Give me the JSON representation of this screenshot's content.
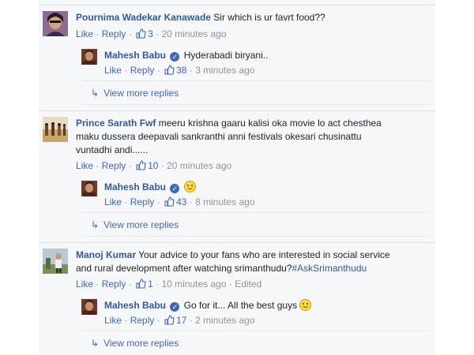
{
  "actions": {
    "like": "Like",
    "reply": "Reply",
    "sep": "·"
  },
  "comments": [
    {
      "author": "Pournima Wadekar Kanawade",
      "text": "Sir which is ur favrt food??",
      "likes": "3",
      "time": "20 minutes ago",
      "reply": {
        "author": "Mahesh Babu",
        "text": "Hyderabadi biryani..",
        "likes": "38",
        "time": "3 minutes ago"
      },
      "more": "View more replies"
    },
    {
      "author": "Prince Sarath Fwf",
      "text_lines": [
        "meeru krishna gaaru kalisi oka movie lo act chesthea",
        "maku dussera deepavali sankranthi anni festivals okesari chusinattu",
        "vuntadhi andi......"
      ],
      "likes": "10",
      "time": "20 minutes ago",
      "reply": {
        "author": "Mahesh Babu",
        "text": "",
        "likes": "43",
        "time": "8 minutes ago"
      },
      "more": "View more replies"
    },
    {
      "author": "Manoj Kumar",
      "text_line1": "Your advice to your fans who are interested in social service",
      "text_line2": "and rural development after watching srimanthudu?",
      "hashtag": "#AskSrimanthudu",
      "likes": "1",
      "time": "10 minutes ago",
      "edited": "Edited",
      "reply": {
        "author": "Mahesh Babu",
        "text": "Go for it... All the best guys",
        "likes": "17",
        "time": "2 minutes ago"
      },
      "more": "View more replies"
    }
  ]
}
